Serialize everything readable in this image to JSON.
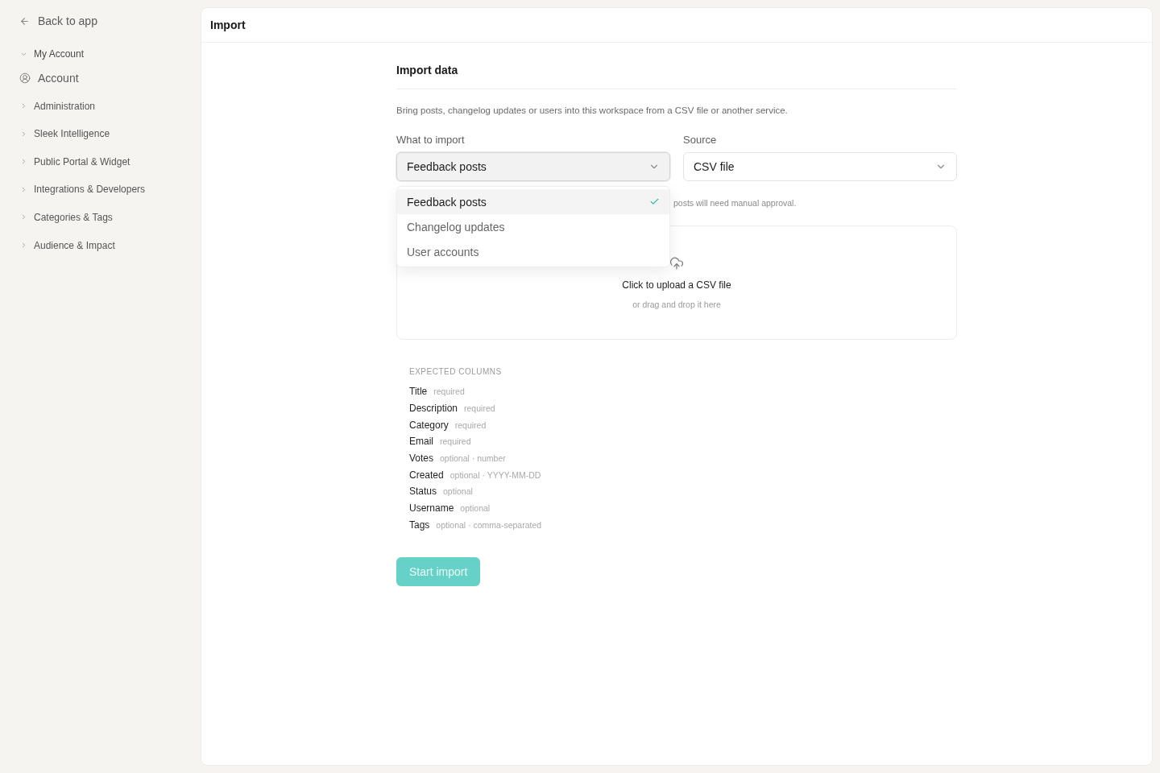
{
  "sidebar": {
    "back_link": "Back to app",
    "groups": [
      {
        "label": "My Account",
        "expanded": true,
        "children": [
          {
            "label": "Account"
          }
        ]
      },
      {
        "label": "Administration",
        "expanded": false
      },
      {
        "label": "Sleek Intelligence",
        "expanded": false
      },
      {
        "label": "Public Portal & Widget",
        "expanded": false
      },
      {
        "label": "Integrations & Developers",
        "expanded": false
      },
      {
        "label": "Categories & Tags",
        "expanded": false
      },
      {
        "label": "Audience & Impact",
        "expanded": false
      }
    ]
  },
  "page": {
    "title": "Import"
  },
  "import": {
    "heading": "Import data",
    "description": "Bring posts, changelog updates or users into this workspace from a CSV file or another service.",
    "fields": [
      {
        "label": "What to import",
        "value": "Feedback posts",
        "open": true,
        "options": [
          {
            "label": "Feedback posts",
            "selected": true
          },
          {
            "label": "Changelog updates",
            "selected": false
          },
          {
            "label": "User accounts",
            "selected": false
          }
        ]
      },
      {
        "label": "Source",
        "value": "CSV file",
        "open": false
      }
    ],
    "hint": "posts will need manual approval.",
    "upload": {
      "title": "Click to upload a CSV file",
      "subtitle": "or drag and drop it here"
    },
    "columns": {
      "heading": "EXPECTED COLUMNS",
      "items": [
        {
          "name": "Title",
          "note": "required"
        },
        {
          "name": "Description",
          "note": "required"
        },
        {
          "name": "Category",
          "note": "required"
        },
        {
          "name": "Email",
          "note": "required"
        },
        {
          "name": "Votes",
          "note": "optional · number"
        },
        {
          "name": "Created",
          "note": "optional · YYYY-MM-DD"
        },
        {
          "name": "Status",
          "note": "optional"
        },
        {
          "name": "Username",
          "note": "optional"
        },
        {
          "name": "Tags",
          "note": "optional · comma-separated"
        }
      ]
    },
    "submit": {
      "label": "Start import",
      "disabled": true
    }
  }
}
